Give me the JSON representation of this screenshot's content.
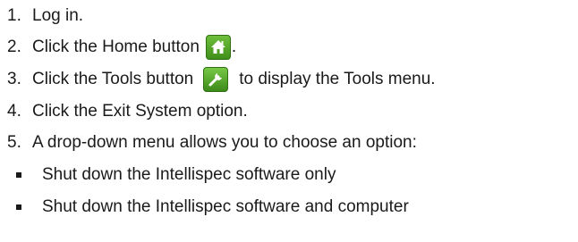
{
  "steps": [
    {
      "number": "1.",
      "text": "Log in."
    },
    {
      "number": "2.",
      "text_before": "Click the Home button",
      "icon": "home-icon",
      "text_after": "."
    },
    {
      "number": "3.",
      "text_before": "Click the Tools button",
      "icon": "wrench-icon",
      "text_after": "to display the Tools menu."
    },
    {
      "number": "4.",
      "text": "Click the Exit System option."
    },
    {
      "number": "5.",
      "text": "A drop-down menu allows you to choose an option:"
    }
  ],
  "options": [
    "Shut down the Intellispec software only",
    "Shut down the Intellispec software and computer"
  ],
  "colors": {
    "icon_green": "#4fa62a",
    "text": "#1a1a1a"
  }
}
